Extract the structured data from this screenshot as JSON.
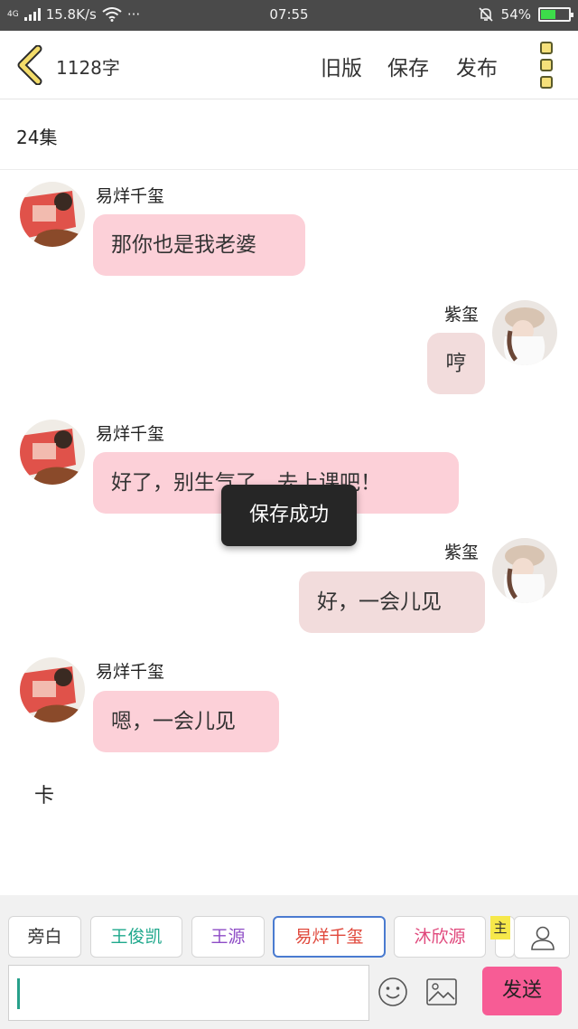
{
  "status_bar": {
    "network": "4G",
    "speed": "15.8K/s",
    "more": "···",
    "time": "07:55",
    "battery": "54%",
    "battery_level": 0.54,
    "icons": [
      "signal-icon",
      "wifi-icon",
      "mute-bell-icon",
      "battery-icon"
    ]
  },
  "header": {
    "word_count": "1128字",
    "old_version_label": "旧版",
    "save_label": "保存",
    "publish_label": "发布"
  },
  "episode_title": "24集",
  "messages": [
    {
      "sender": "易烊千玺",
      "side": "left",
      "text": "那你也是我老婆"
    },
    {
      "sender": "紫玺",
      "side": "right",
      "text": "哼"
    },
    {
      "sender": "易烊千玺",
      "side": "left",
      "text": "好了，别生气了，去上课吧！"
    },
    {
      "sender": "紫玺",
      "side": "right",
      "text": "好，一会儿见"
    },
    {
      "sender": "易烊千玺",
      "side": "left",
      "text": "嗯，一会儿见"
    }
  ],
  "toast": "保存成功",
  "end_mark": "卡",
  "character_bar": {
    "chips": [
      {
        "label": "旁白",
        "color": "#333333"
      },
      {
        "label": "王俊凯",
        "color": "#1fa88c"
      },
      {
        "label": "王源",
        "color": "#8e4cc6"
      },
      {
        "label": "易烊千玺",
        "color": "#e0483c"
      },
      {
        "label": "沐欣源",
        "color": "#e0487c"
      }
    ],
    "main_tag": "主"
  },
  "composer": {
    "input_value": "",
    "input_placeholder": "",
    "send_label": "发送"
  },
  "colors": {
    "left_bubble": "#fcd0d8",
    "right_bubble": "#f2dcdc",
    "send_button": "#f75c95",
    "selected_chip_border": "#4a7bd0"
  }
}
